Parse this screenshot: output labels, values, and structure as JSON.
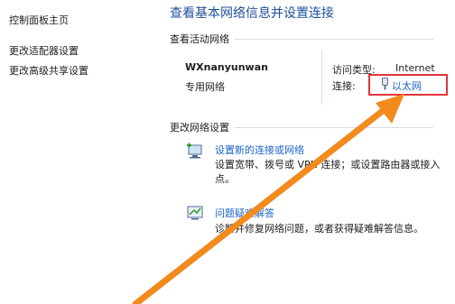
{
  "sidebar": {
    "home": "控制面板主页",
    "adapter_settings": "更改适配器设置",
    "sharing_settings": "更改高级共享设置"
  },
  "main": {
    "title": "查看基本网络信息并设置连接",
    "active_heading": "查看活动网络",
    "network_name": "WXnanyunwan",
    "network_type": "专用网络",
    "access_type_label": "访问类型:",
    "access_type_value": "Internet",
    "connection_label": "连接:",
    "connection_value": "以太网",
    "change_heading": "更改网络设置",
    "tasks": [
      {
        "title": "设置新的连接或网络",
        "desc": "设置宽带、拨号或 VPN 连接；或设置路由器或接入点。"
      },
      {
        "title": "问题疑难解答",
        "desc": "诊断并修复网络问题，或者获得疑难解答信息。"
      }
    ]
  },
  "colors": {
    "link": "#1e64c8",
    "highlight": "#e2343a",
    "arrow": "#f28a1e"
  }
}
